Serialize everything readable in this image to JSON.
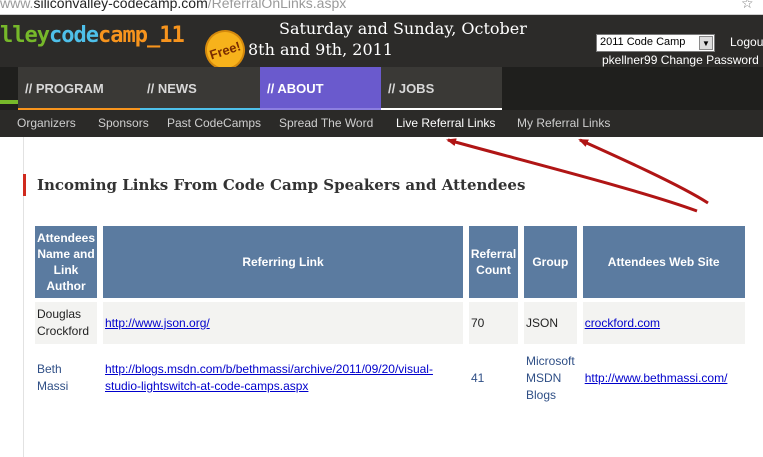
{
  "browser": {
    "url_prefix": "www.",
    "url_host": "siliconvalley-codecamp.com",
    "url_path": "/ReferralOnLinks.aspx"
  },
  "header": {
    "logo": {
      "part1": "lley",
      "part2": "code",
      "part3": "camp_11"
    },
    "badge": "Free!",
    "dates_line1": "Saturday and Sunday, October",
    "dates_line2": "8th and 9th, 2011",
    "year_select": "2011 Code Camp",
    "logout": "Logou",
    "user": "pkellner99",
    "change_password": "Change Password"
  },
  "nav": {
    "tabs": [
      {
        "label": "// PROGRAM",
        "color": "#f7941d"
      },
      {
        "label": "// NEWS",
        "color": "#4ec0ea"
      },
      {
        "label": "// ABOUT",
        "color": "#8c7fe0"
      },
      {
        "label": "// JOBS",
        "color": "#ffffff"
      }
    ],
    "subitems": [
      "Organizers",
      "Sponsors",
      "Past CodeCamps",
      "Spread The Word",
      "Live Referral Links",
      "My Referral Links"
    ]
  },
  "page": {
    "heading": "Incoming Links From Code Camp Speakers and Attendees"
  },
  "table": {
    "headers": [
      "Attendees Name and Link Author",
      "Referring Link",
      "Referral Count",
      "Group",
      "Attendees Web Site"
    ],
    "rows": [
      {
        "name": "Douglas Crockford",
        "link": "http://www.json.org/",
        "count": "70",
        "group": "JSON",
        "site": "crockford.com"
      },
      {
        "name": "Beth Massi",
        "link": "http://blogs.msdn.com/b/bethmassi/archive/2011/09/20/visual-studio-lightswitch-at-code-camps.aspx",
        "count": "41",
        "group": "Microsoft MSDN Blogs",
        "site": "http://www.bethmassi.com/"
      }
    ]
  },
  "colors": {
    "header_bg": "#2c2b29",
    "table_header_bg": "#5b7ba0",
    "annotation_arrow": "#b01515"
  }
}
